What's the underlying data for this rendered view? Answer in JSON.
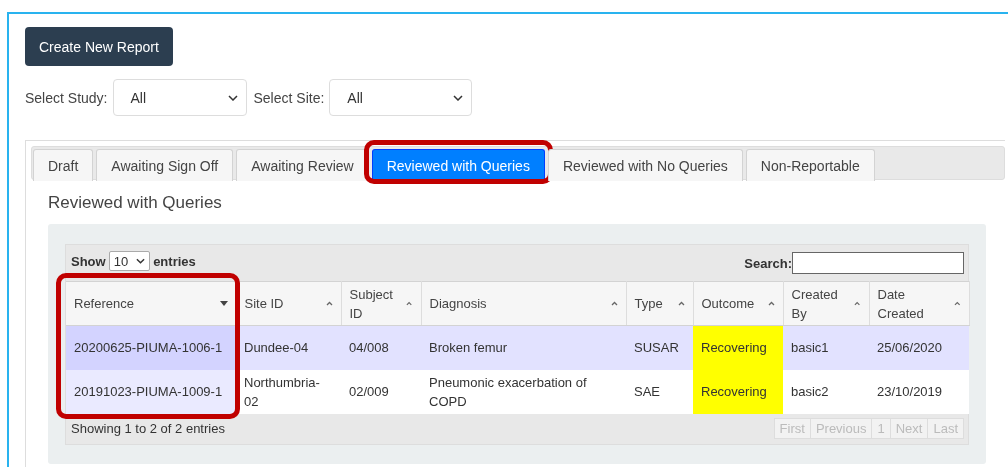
{
  "create_button": "Create New Report",
  "filters": [
    {
      "label": "Select Study:",
      "value": "All"
    },
    {
      "label": "Select Site:",
      "value": "All"
    }
  ],
  "tabs": [
    {
      "label": "Draft",
      "selected": false,
      "highlighted": false
    },
    {
      "label": "Awaiting Sign Off",
      "selected": false,
      "highlighted": false
    },
    {
      "label": "Awaiting Review",
      "selected": false,
      "highlighted": false
    },
    {
      "label": "Reviewed with Queries",
      "selected": true,
      "highlighted": true
    },
    {
      "label": "Reviewed with No Queries",
      "selected": false,
      "highlighted": false
    },
    {
      "label": "Non-Reportable",
      "selected": false,
      "highlighted": false
    }
  ],
  "section_title": "Reviewed with Queries",
  "length": {
    "show": "Show",
    "value": "10",
    "entries": "entries"
  },
  "search": {
    "label": "Search:"
  },
  "columns": [
    {
      "label": "Reference",
      "sorted": true,
      "highlighted": true
    },
    {
      "label": "Site ID",
      "sorted": false,
      "highlighted": false
    },
    {
      "label": "Subject ID",
      "sorted": false,
      "highlighted": false
    },
    {
      "label": "Diagnosis",
      "sorted": false,
      "highlighted": false
    },
    {
      "label": "Type",
      "sorted": false,
      "highlighted": false
    },
    {
      "label": "Outcome",
      "sorted": false,
      "highlighted": false
    },
    {
      "label": "Created By",
      "sorted": false,
      "highlighted": false
    },
    {
      "label": "Date Created",
      "sorted": false,
      "highlighted": false
    }
  ],
  "rows": [
    {
      "selected": true,
      "cells": [
        {
          "text": "20200625-PIUMA-1006-1"
        },
        {
          "text": "Dundee-04"
        },
        {
          "text": "04/008"
        },
        {
          "text": "Broken femur"
        },
        {
          "text": "SUSAR"
        },
        {
          "text": "Recovering",
          "color": "#ffff00"
        },
        {
          "text": "basic1"
        },
        {
          "text": "25/06/2020"
        }
      ]
    },
    {
      "selected": false,
      "cells": [
        {
          "text": "20191023-PIUMA-1009-1"
        },
        {
          "text": "Northumbria-02"
        },
        {
          "text": "02/009"
        },
        {
          "text": "Pneumonic exacerbation of COPD"
        },
        {
          "text": "SAE"
        },
        {
          "text": "Recovering",
          "color": "#ffff00"
        },
        {
          "text": "basic2"
        },
        {
          "text": "23/10/2019"
        }
      ]
    }
  ],
  "info": "Showing 1 to 2 of 2 entries",
  "pagination": [
    {
      "label": "First",
      "disabled": true
    },
    {
      "label": "Previous",
      "disabled": true
    },
    {
      "label": "1",
      "disabled": true
    },
    {
      "label": "Next",
      "disabled": true
    },
    {
      "label": "Last",
      "disabled": true
    }
  ]
}
